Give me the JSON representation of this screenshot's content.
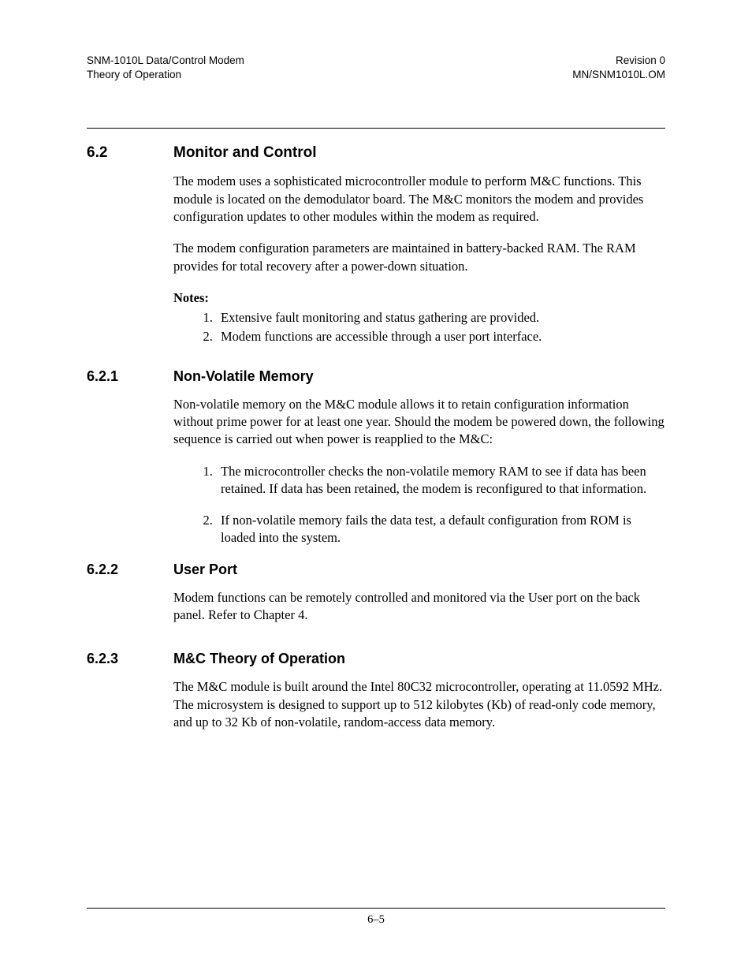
{
  "header": {
    "left_line1": "SNM-1010L Data/Control Modem",
    "left_line2": "Theory of Operation",
    "right_line1": "Revision 0",
    "right_line2": "MN/SNM1010L.OM"
  },
  "sections": {
    "s62": {
      "num": "6.2",
      "title": "Monitor and Control",
      "para1": "The modem uses a sophisticated microcontroller module to perform M&C functions. This module is located on the demodulator board. The M&C monitors the modem and provides configuration updates to other modules within the modem as required.",
      "para2": "The modem configuration parameters are maintained in battery-backed RAM. The RAM provides for total recovery after a power-down situation.",
      "notes_label": "Notes:",
      "notes": [
        "Extensive fault monitoring and status gathering are provided.",
        "Modem functions are accessible through a user port interface."
      ]
    },
    "s621": {
      "num": "6.2.1",
      "title": "Non-Volatile Memory",
      "para1": "Non-volatile memory on the M&C module allows it to retain configuration information without prime power for at least one year. Should the modem be powered down, the following sequence is carried out when power is reapplied to the M&C:",
      "steps": [
        "The microcontroller checks the non-volatile memory RAM to see if data has been retained. If data has been retained, the modem is reconfigured to that information.",
        "If non-volatile memory fails the data test, a default configuration from ROM is loaded into the system."
      ]
    },
    "s622": {
      "num": "6.2.2",
      "title": "User Port",
      "para1": "Modem functions can be remotely controlled and monitored via the User port on the back panel. Refer to Chapter 4."
    },
    "s623": {
      "num": "6.2.3",
      "title": "M&C Theory of Operation",
      "para1": "The M&C module is built around the Intel 80C32 microcontroller, operating at 11.0592 MHz. The microsystem is designed to support up to 512 kilobytes (Kb) of read-only code memory, and up to 32 Kb of non-volatile, random-access data memory."
    }
  },
  "footer": {
    "page_num": "6–5"
  }
}
